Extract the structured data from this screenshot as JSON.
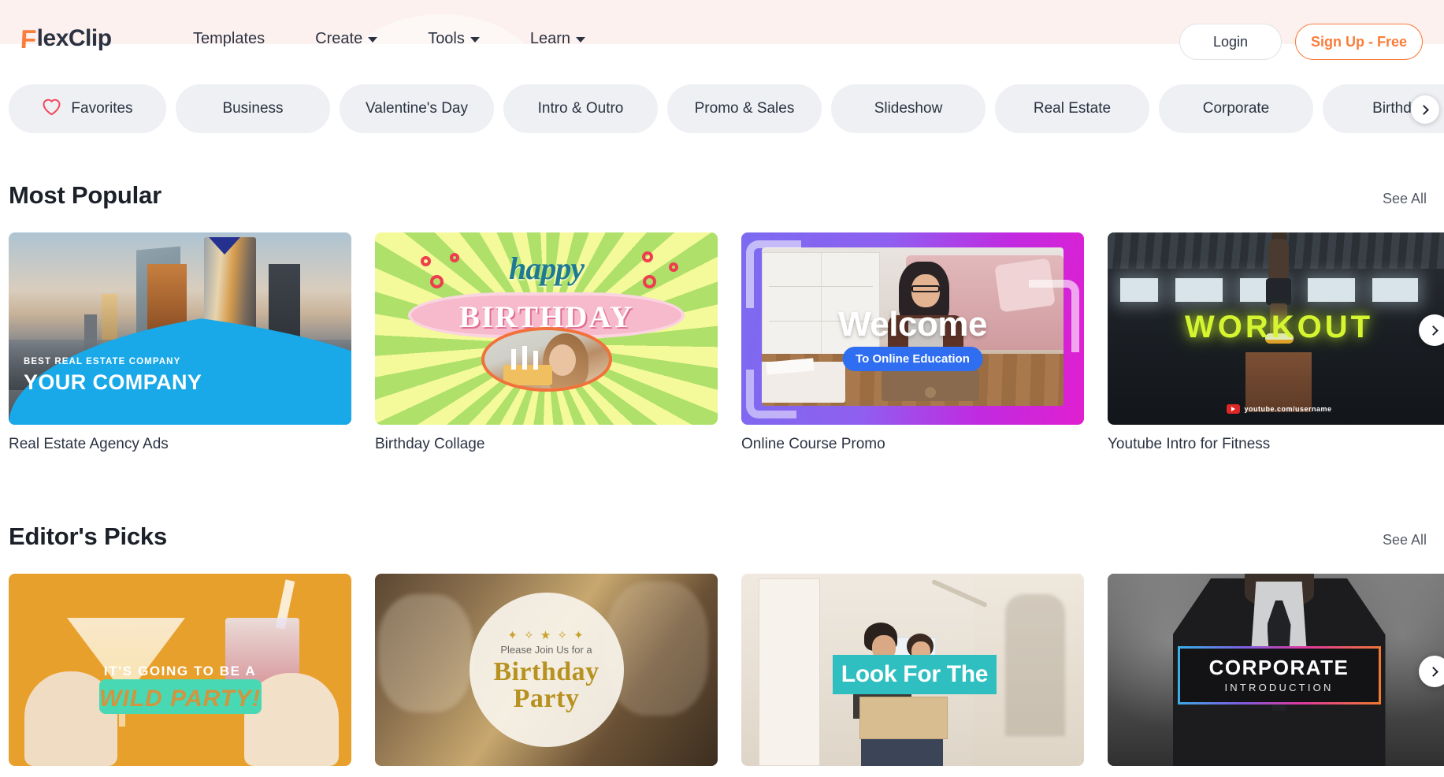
{
  "brand": {
    "name_mark": "F",
    "name_rest": "lexClip",
    "accent_color": "#fa7d3b",
    "banner_color": "#fdf1ef"
  },
  "header": {
    "nav": [
      {
        "label": "Templates",
        "has_caret": false
      },
      {
        "label": "Create",
        "has_caret": true
      },
      {
        "label": "Tools",
        "has_caret": true
      },
      {
        "label": "Learn",
        "has_caret": true
      }
    ],
    "login_label": "Login",
    "signup_label": "Sign Up - Free"
  },
  "categories": {
    "favorites_icon": "heart-icon",
    "items": [
      "Favorites",
      "Business",
      "Valentine's Day",
      "Intro & Outro",
      "Promo & Sales",
      "Slideshow",
      "Real Estate",
      "Corporate",
      "Birthday"
    ],
    "next_icon": "chevron-right-icon"
  },
  "sections": [
    {
      "title": "Most Popular",
      "see_all": "See All",
      "next_icon": "chevron-right-icon",
      "cards": [
        {
          "title": "Real Estate Agency Ads",
          "art": "realestate",
          "overlay": {
            "line1": "BEST REAL ESTATE COMPANY",
            "line2": "YOUR COMPANY"
          }
        },
        {
          "title": "Birthday Collage",
          "art": "birthday",
          "overlay": {
            "line1": "happy",
            "line2": "BIRTHDAY"
          }
        },
        {
          "title": "Online Course Promo",
          "art": "course",
          "overlay": {
            "line1": "Welcome",
            "line2": "To Online Education"
          }
        },
        {
          "title": "Youtube Intro for Fitness",
          "art": "workout",
          "overlay": {
            "line1": "WORKOUT",
            "line2": "youtube.com/username"
          }
        }
      ]
    },
    {
      "title": "Editor's Picks",
      "see_all": "See All",
      "next_icon": "chevron-right-icon",
      "cards": [
        {
          "title": "",
          "art": "wild",
          "overlay": {
            "line1": "IT'S GOING TO BE A",
            "line2": "WILD PARTY!"
          }
        },
        {
          "title": "",
          "art": "party",
          "overlay": {
            "line0": "✦ ✧ ★ ✧ ✦",
            "line1": "Please Join Us for a",
            "line2": "Birthday",
            "line3": "Party"
          }
        },
        {
          "title": "",
          "art": "look",
          "overlay": {
            "line1": "Look For The"
          }
        },
        {
          "title": "",
          "art": "corp",
          "overlay": {
            "line1": "CORPORATE",
            "line2": "INTRODUCTION"
          }
        }
      ]
    }
  ]
}
